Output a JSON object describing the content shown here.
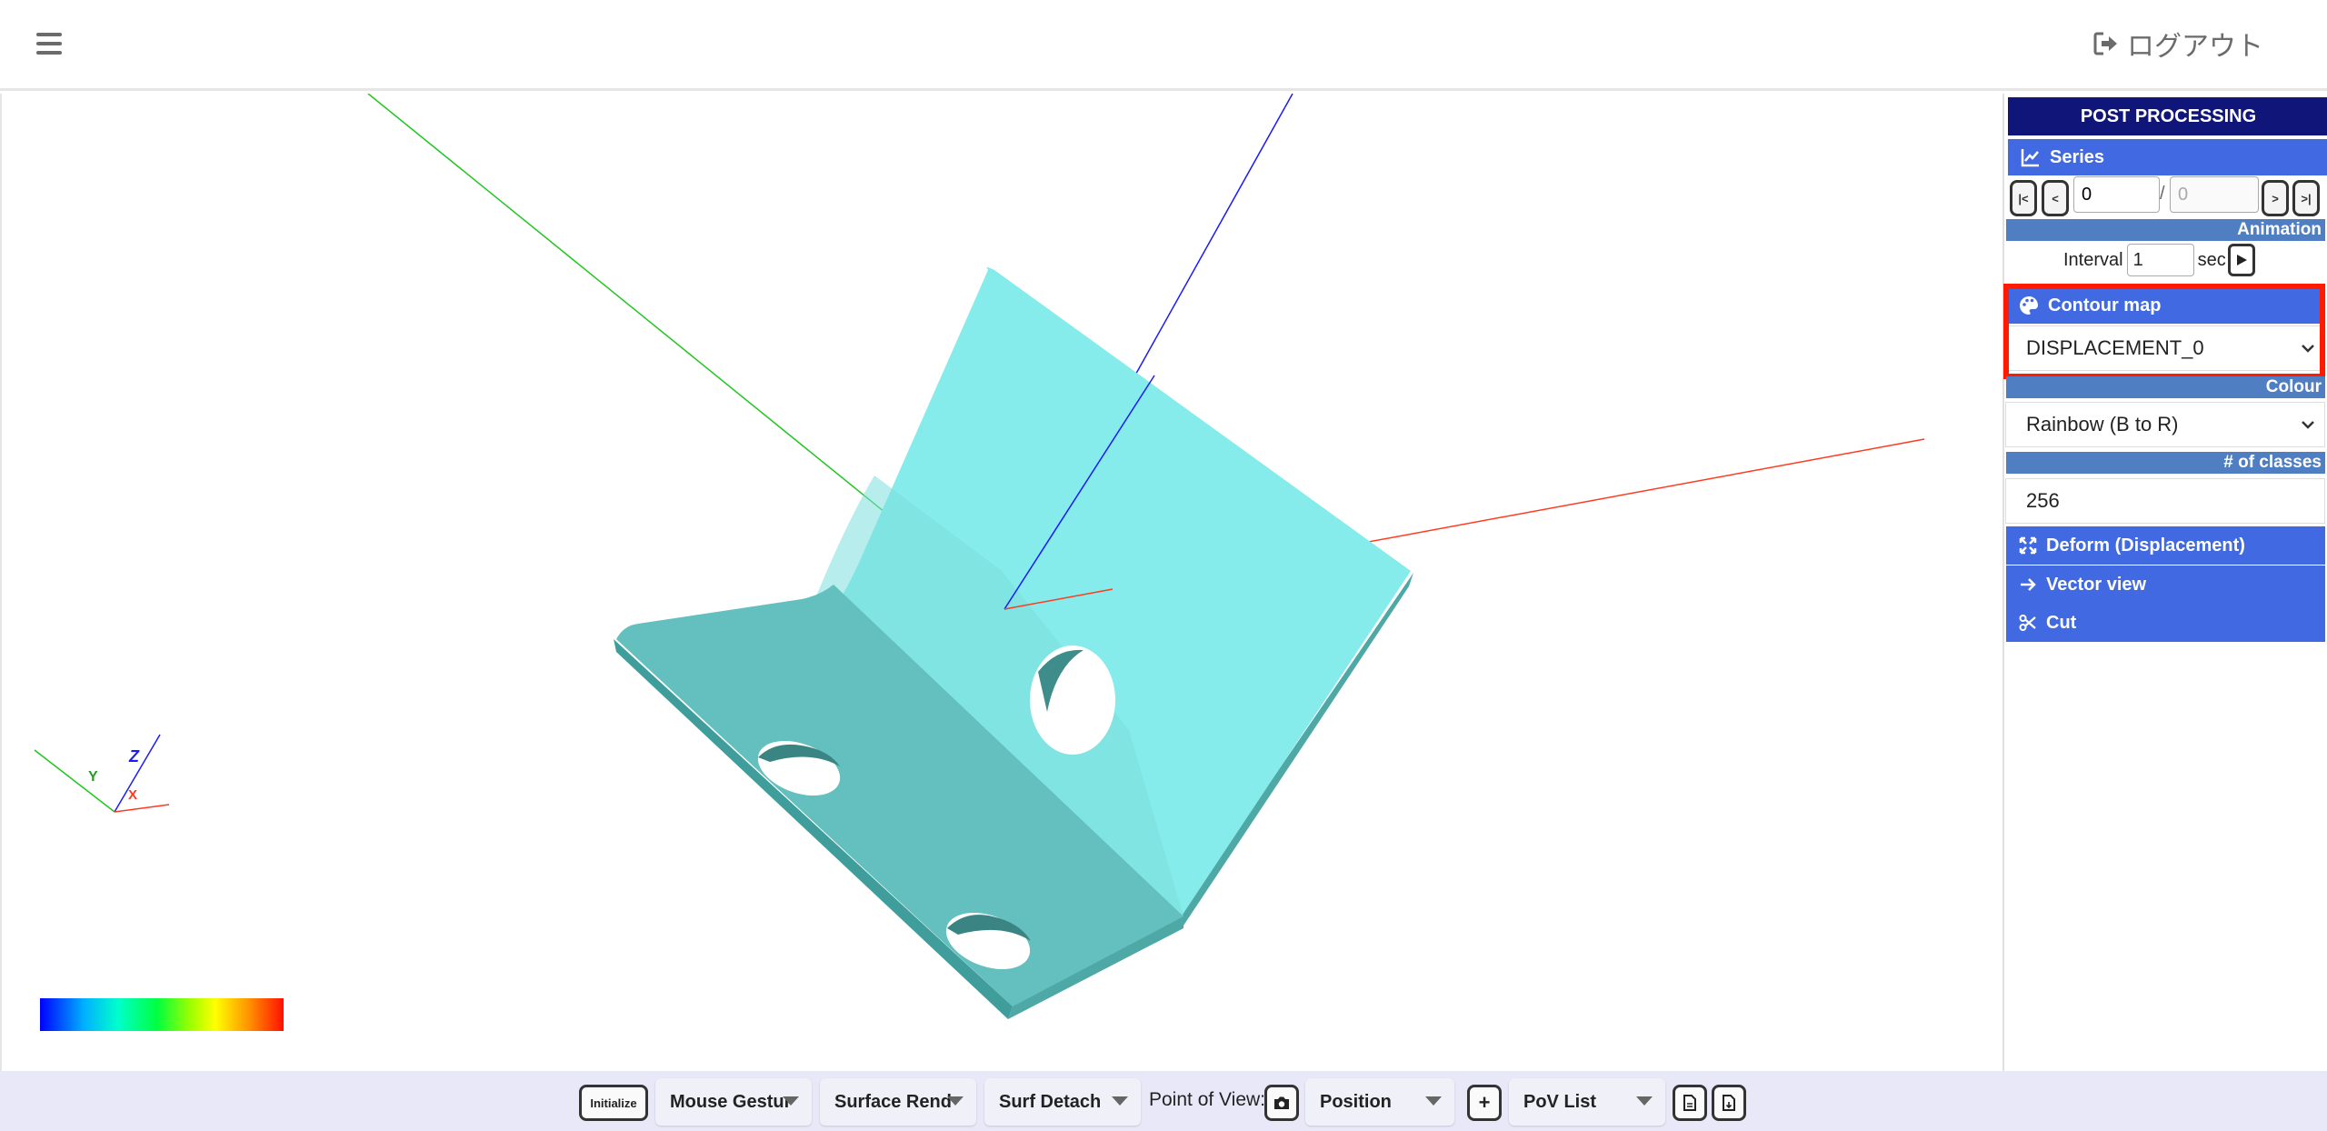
{
  "header": {
    "logout_label": "ログアウト",
    "menu_icon": "hamburger-icon",
    "logout_icon": "sign-out-icon"
  },
  "panel": {
    "title": "POST PROCESSING",
    "series": {
      "label": "Series",
      "icon": "line-chart-icon",
      "first_label": "|<",
      "prev_label": "<",
      "next_label": ">",
      "last_label": ">|",
      "current_step": "0",
      "separator": "/",
      "total_steps": "0"
    },
    "animation": {
      "label": "Animation",
      "interval_label": "Interval",
      "interval_value": "1",
      "unit": "sec",
      "play_icon": "play-icon"
    },
    "contour": {
      "label": "Contour map",
      "icon": "palette-icon",
      "selected": "DISPLACEMENT_0"
    },
    "colour": {
      "label": "Colour",
      "selected": "Rainbow (B to R)"
    },
    "classes": {
      "label": "# of classes",
      "value": "256"
    },
    "actions": [
      {
        "label": "Deform (Displacement)",
        "icon": "expand-icon"
      },
      {
        "label": "Vector view",
        "icon": "arrow-right-icon"
      },
      {
        "label": "Cut",
        "icon": "scissors-icon"
      }
    ]
  },
  "viewport": {
    "axis_labels": {
      "x": "X",
      "y": "Y",
      "z": "Z"
    },
    "colors": {
      "part_light": "#86eceb",
      "part_dark": "#5fb9b7",
      "x_axis": "#ff3b1f",
      "y_axis": "#21c521",
      "z_axis": "#1a1aff"
    }
  },
  "toolbar": {
    "initialize": "Initialize",
    "mouse_gesture": "Mouse Gestur",
    "surface_render": "Surface Rend",
    "surf_detach": "Surf Detach",
    "pov_label": "Point of View:",
    "camera_icon": "camera-icon",
    "position": "Position",
    "add_label": "+",
    "pov_list": "PoV List",
    "save_icon": "file-save-icon",
    "load_icon": "file-load-icon"
  }
}
